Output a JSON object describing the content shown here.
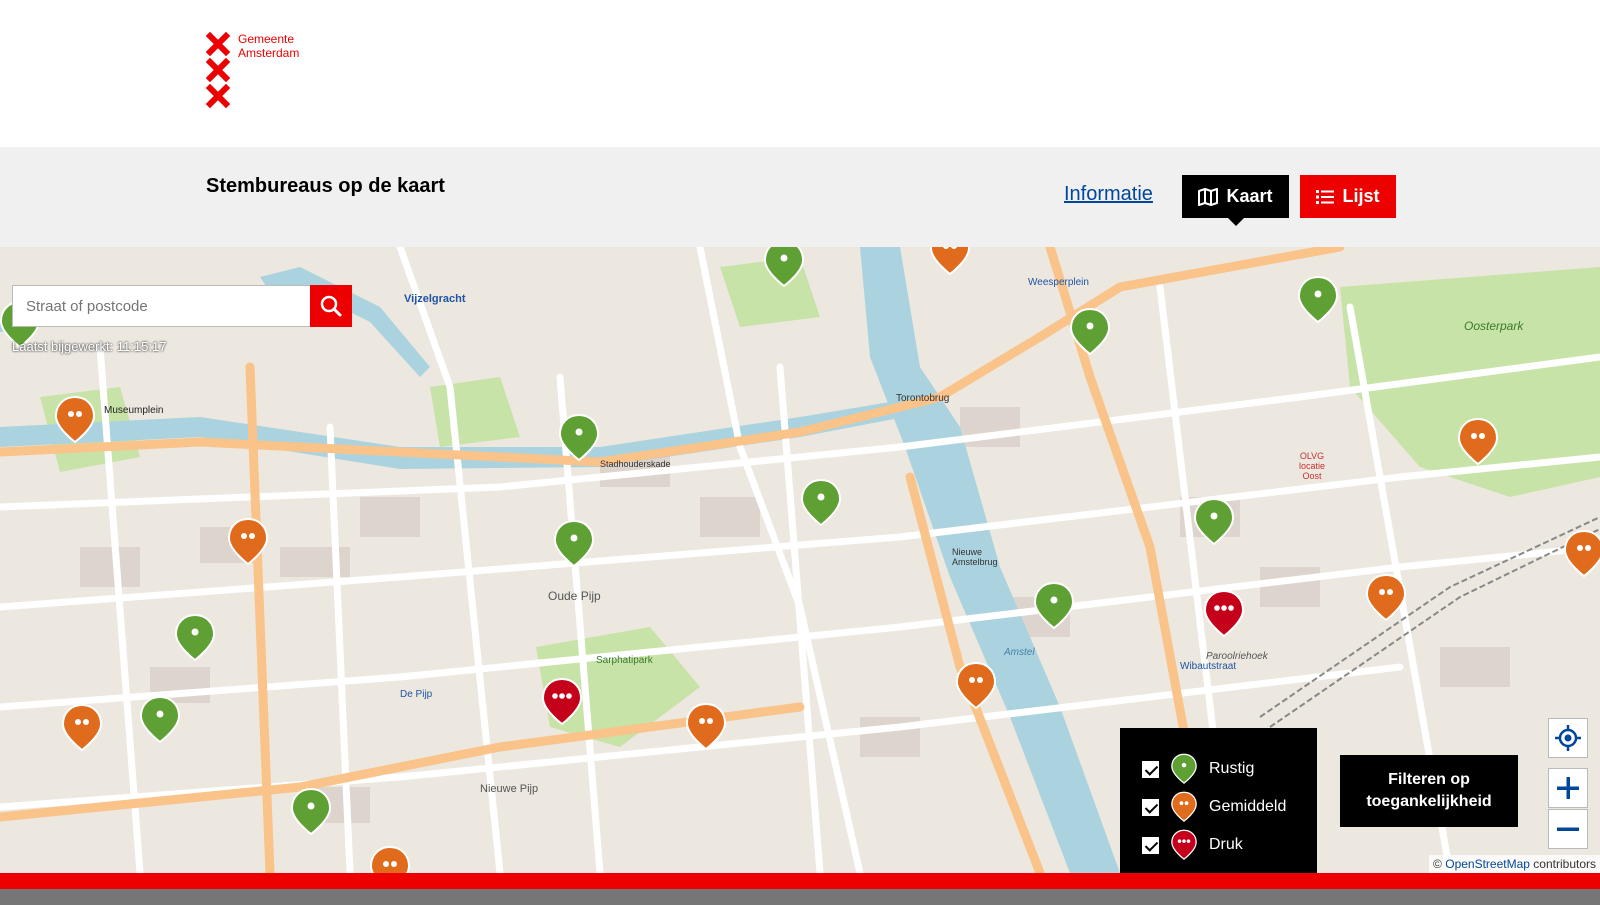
{
  "header": {
    "logo_line1": "Gemeente",
    "logo_line2": "Amsterdam",
    "page_title": "Stembureaus op de kaart",
    "info_link": "Informatie",
    "kaart_button": "Kaart",
    "lijst_button": "Lijst"
  },
  "colors": {
    "brand_red": "#ec0000",
    "rustig": "#5fa035",
    "gemiddeld": "#e06b1d",
    "druk": "#c4001a"
  },
  "search": {
    "placeholder": "Straat of postcode",
    "updated_label": "Laatst bijgewerkt: 11:15:17"
  },
  "legend": {
    "items": [
      {
        "label": "Rustig",
        "status": "rustig"
      },
      {
        "label": "Gemiddeld",
        "status": "gemiddeld"
      },
      {
        "label": "Druk",
        "status": "druk"
      }
    ]
  },
  "filter_button_line1": "Filteren op",
  "filter_button_line2": "toegankelijkheid",
  "attribution": {
    "prefix": "©",
    "link": "OpenStreetMap",
    "suffix": "contributors"
  },
  "map_labels": {
    "vijzelgracht": "Vijzelgracht",
    "museumplein": "Museumplein",
    "oude_pijp": "Oude Pijp",
    "sarphatipark": "Sarphatipark",
    "de_pijp": "De Pijp",
    "nieuwe_pijp": "Nieuwe Pijp",
    "oosterpark": "Oosterpark",
    "wibautstraat": "Wibautstraat",
    "weesperplein": "Weesperplein",
    "paroolriehoek": "Paroolriehoek",
    "stadhouderskade": "Stadhouderskade",
    "nieuwe_amstelbrug": "Nieuwe Amstelbrug",
    "torontobrug": "Torontobrug",
    "amstel": "Amstel",
    "olvg": "OLVG locatie Oost"
  }
}
